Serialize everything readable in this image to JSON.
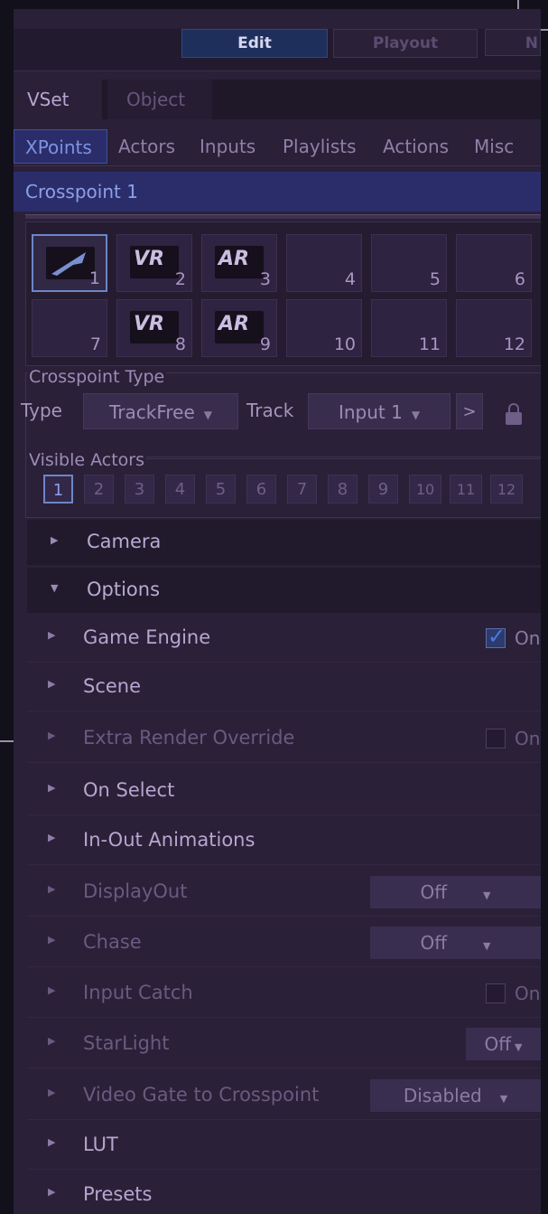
{
  "modes": {
    "edit": "Edit",
    "playout": "Playout",
    "third": "N"
  },
  "top_tabs": [
    {
      "label": "VSet"
    },
    {
      "label": "Object"
    }
  ],
  "sub_tabs": [
    {
      "label": "XPoints"
    },
    {
      "label": "Actors"
    },
    {
      "label": "Inputs"
    },
    {
      "label": "Playlists"
    },
    {
      "label": "Actions"
    },
    {
      "label": "Misc"
    }
  ],
  "crosspoint_title": "Crosspoint 1",
  "crosspoints": [
    {
      "num": "1",
      "icon": "track-icon",
      "glyph": ""
    },
    {
      "num": "2",
      "icon": "vr-icon",
      "glyph": "VR"
    },
    {
      "num": "3",
      "icon": "ar-icon",
      "glyph": "AR"
    },
    {
      "num": "4"
    },
    {
      "num": "5"
    },
    {
      "num": "6"
    },
    {
      "num": "7"
    },
    {
      "num": "8",
      "icon": "vr-icon",
      "glyph": "VR"
    },
    {
      "num": "9",
      "icon": "ar-icon",
      "glyph": "AR"
    },
    {
      "num": "10"
    },
    {
      "num": "11"
    },
    {
      "num": "12"
    }
  ],
  "crosspoint_type": {
    "group_title": "Crosspoint Type",
    "type_label": "Type",
    "type_value": "TrackFree",
    "track_label": "Track",
    "track_value": "Input 1",
    "next_label": ">"
  },
  "visible_actors": {
    "group_title": "Visible Actors",
    "items": [
      "1",
      "2",
      "3",
      "4",
      "5",
      "6",
      "7",
      "8",
      "9",
      "10",
      "11",
      "12"
    ]
  },
  "sections": {
    "camera": "Camera",
    "options": "Options"
  },
  "options": {
    "game_engine": {
      "label": "Game Engine",
      "checkbox": "On"
    },
    "scene": {
      "label": "Scene"
    },
    "extra_render": {
      "label": "Extra Render Override",
      "checkbox": "On"
    },
    "on_select": {
      "label": "On Select"
    },
    "in_out": {
      "label": "In-Out Animations"
    },
    "display_out": {
      "label": "DisplayOut",
      "value": "Off"
    },
    "chase": {
      "label": "Chase",
      "value": "Off"
    },
    "input_catch": {
      "label": "Input Catch",
      "checkbox": "On"
    },
    "starlight": {
      "label": "StarLight",
      "value": "Off"
    },
    "video_gate": {
      "label": "Video Gate to Crosspoint",
      "value": "Disabled"
    },
    "lut": {
      "label": "LUT"
    },
    "presets": {
      "label": "Presets"
    }
  }
}
